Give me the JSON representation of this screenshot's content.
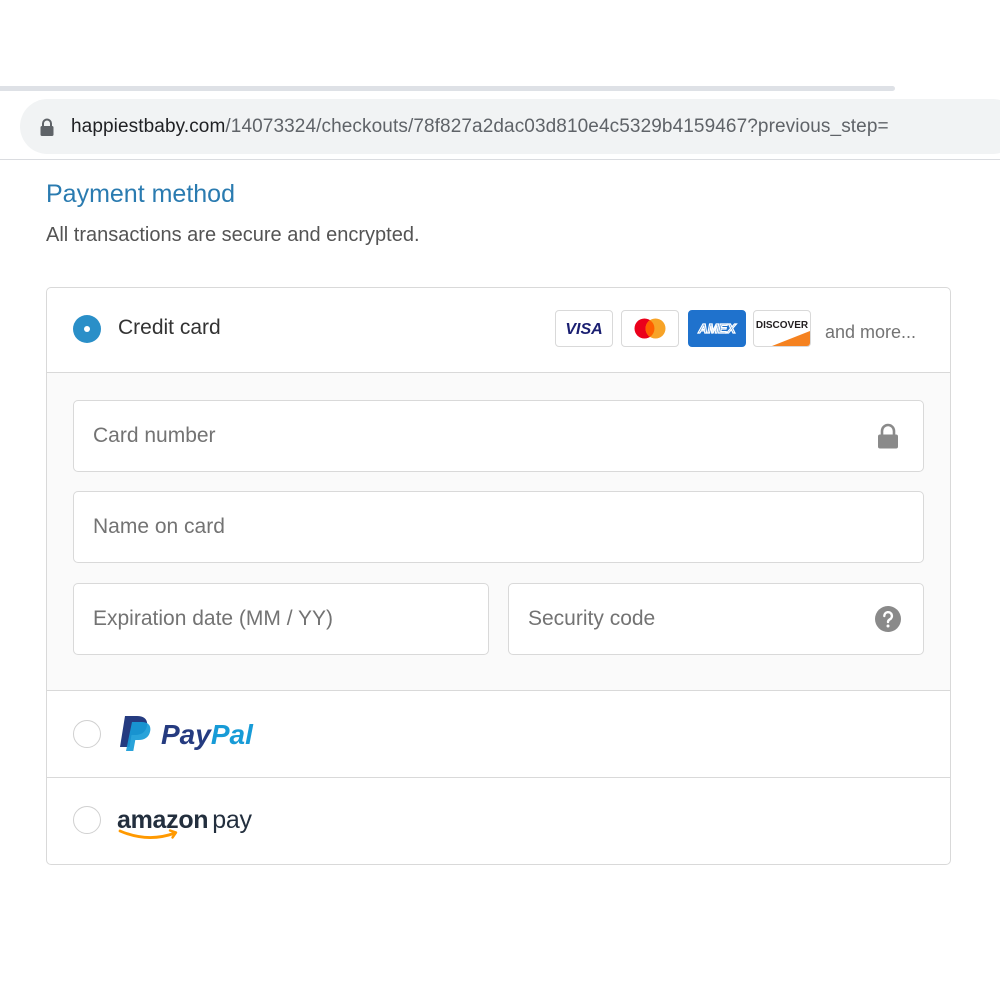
{
  "browser": {
    "url_host": "happiestbaby.com",
    "url_path": "/14073324/checkouts/78f827a2dac03d810e4c5329b4159467?previous_step="
  },
  "payment": {
    "title": "Payment method",
    "subtitle": "All transactions are secure and encrypted.",
    "credit_card": {
      "label": "Credit card",
      "selected": true,
      "card_brands": [
        "VISA",
        "AMEX",
        "DISCOVER"
      ],
      "and_more": "and more..."
    },
    "fields": {
      "card_number_placeholder": "Card number",
      "name_placeholder": "Name on card",
      "expiration_placeholder": "Expiration date (MM / YY)",
      "security_code_placeholder": "Security code"
    },
    "paypal": {
      "brand": "PayPal",
      "selected": false
    },
    "amazon": {
      "brand": "amazon pay",
      "selected": false
    }
  },
  "colors": {
    "accent": "#2a8fc8",
    "title": "#2a7bb0",
    "paypal_dark": "#253b80",
    "paypal_light": "#179bd7",
    "amex": "#1f72cd",
    "discover_orange": "#f58220",
    "amazon_orange": "#ff9900"
  },
  "icons": [
    "lock-icon",
    "help-icon",
    "visa-logo",
    "mastercard-logo",
    "amex-logo",
    "discover-logo",
    "paypal-logo",
    "amazon-pay-logo"
  ]
}
